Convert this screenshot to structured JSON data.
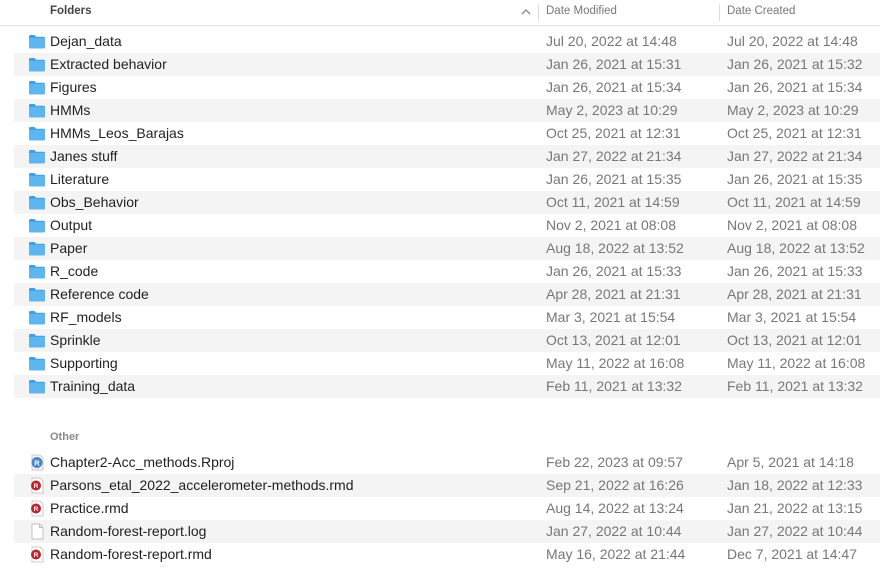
{
  "header": {
    "name_col": "Folders",
    "modified_col": "Date Modified",
    "created_col": "Date Created"
  },
  "colors": {
    "folder": "#5fb6ee",
    "folder_tab": "#3f9fe0",
    "rmd_badge": "#b8232f",
    "rproj_badge": "#4a86c7",
    "stripe": "#f4f4f4"
  },
  "folders": [
    {
      "name": "Dejan_data",
      "modified": "Jul 20, 2022 at 14:48",
      "created": "Jul 20, 2022 at 14:48"
    },
    {
      "name": "Extracted behavior",
      "modified": "Jan 26, 2021 at 15:31",
      "created": "Jan 26, 2021 at 15:32"
    },
    {
      "name": "Figures",
      "modified": "Jan 26, 2021 at 15:34",
      "created": "Jan 26, 2021 at 15:34"
    },
    {
      "name": "HMMs",
      "modified": "May 2, 2023 at 10:29",
      "created": "May 2, 2023 at 10:29"
    },
    {
      "name": "HMMs_Leos_Barajas",
      "modified": "Oct 25, 2021 at 12:31",
      "created": "Oct 25, 2021 at 12:31"
    },
    {
      "name": "Janes stuff",
      "modified": "Jan 27, 2022 at 21:34",
      "created": "Jan 27, 2022 at 21:34"
    },
    {
      "name": "Literature",
      "modified": "Jan 26, 2021 at 15:35",
      "created": "Jan 26, 2021 at 15:35"
    },
    {
      "name": "Obs_Behavior",
      "modified": "Oct 11, 2021 at 14:59",
      "created": "Oct 11, 2021 at 14:59"
    },
    {
      "name": "Output",
      "modified": "Nov 2, 2021 at 08:08",
      "created": "Nov 2, 2021 at 08:08"
    },
    {
      "name": "Paper",
      "modified": "Aug 18, 2022 at 13:52",
      "created": "Aug 18, 2022 at 13:52"
    },
    {
      "name": "R_code",
      "modified": "Jan 26, 2021 at 15:33",
      "created": "Jan 26, 2021 at 15:33"
    },
    {
      "name": "Reference code",
      "modified": "Apr 28, 2021 at 21:31",
      "created": "Apr 28, 2021 at 21:31"
    },
    {
      "name": "RF_models",
      "modified": "Mar 3, 2021 at 15:54",
      "created": "Mar 3, 2021 at 15:54"
    },
    {
      "name": "Sprinkle",
      "modified": "Oct 13, 2021 at 12:01",
      "created": "Oct 13, 2021 at 12:01"
    },
    {
      "name": "Supporting",
      "modified": "May 11, 2022 at 16:08",
      "created": "May 11, 2022 at 16:08"
    },
    {
      "name": "Training_data",
      "modified": "Feb 11, 2021 at 13:32",
      "created": "Feb 11, 2021 at 13:32"
    }
  ],
  "other_label": "Other",
  "files": [
    {
      "name": "Chapter2-Acc_methods.Rproj",
      "icon": "rproj-icon",
      "modified": "Feb 22, 2023 at 09:57",
      "created": "Apr 5, 2021 at 14:18"
    },
    {
      "name": "Parsons_etal_2022_accelerometer-methods.rmd",
      "icon": "rmd-file-icon",
      "modified": "Sep 21, 2022 at 16:26",
      "created": "Jan 18, 2022 at 12:33"
    },
    {
      "name": "Practice.rmd",
      "icon": "rmd-file-icon",
      "modified": "Aug 14, 2022 at 13:24",
      "created": "Jan 21, 2022 at 13:15"
    },
    {
      "name": "Random-forest-report.log",
      "icon": "document-icon",
      "modified": "Jan 27, 2022 at 10:44",
      "created": "Jan 27, 2022 at 10:44"
    },
    {
      "name": "Random-forest-report.rmd",
      "icon": "rmd-file-icon",
      "modified": "May 16, 2022 at 21:44",
      "created": "Dec 7, 2021 at 14:47"
    }
  ]
}
